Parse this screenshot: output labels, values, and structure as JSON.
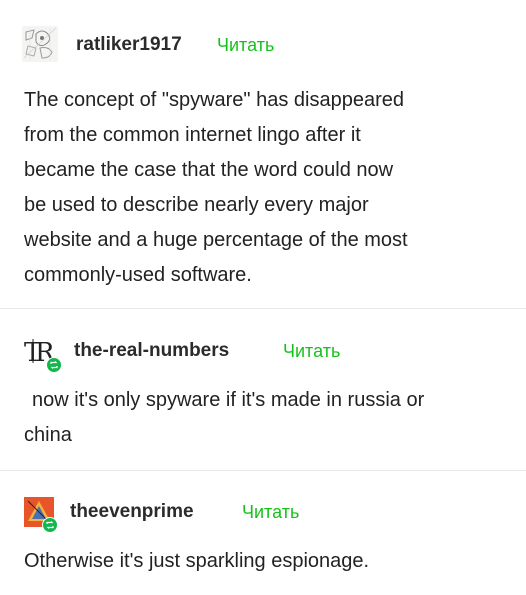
{
  "posts": [
    {
      "username": "ratliker1917",
      "follow_label": "Читать",
      "lines": [
        "The concept of \"spyware\" has disappeared",
        "from the common internet lingo after it",
        "became the case that the word could now",
        "be used to describe nearly every major",
        "website and a huge percentage of the most",
        "commonly-used software."
      ]
    },
    {
      "username": "the-real-numbers",
      "follow_label": "Читать",
      "lines": [
        "now it's only spyware if it's made in russia or",
        "china"
      ]
    },
    {
      "username": "theevenprime",
      "follow_label": "Читать",
      "lines": [
        "Otherwise it's just sparkling espionage."
      ]
    }
  ],
  "colors": {
    "follow": "#17c11b",
    "reblog_badge": "#13b84d",
    "divider": "#e8e8e8"
  }
}
